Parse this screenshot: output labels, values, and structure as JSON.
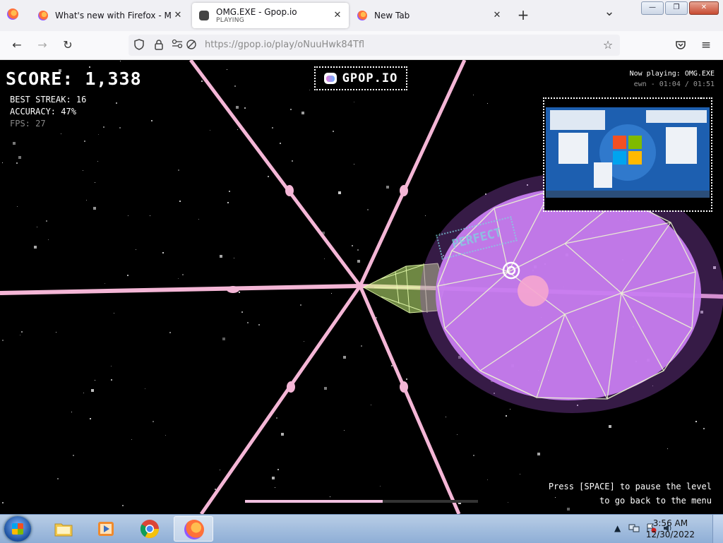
{
  "browser": {
    "tabs": [
      {
        "title": "What's new with Firefox - More",
        "subtitle": "",
        "active": false
      },
      {
        "title": "OMG.EXE - Gpop.io",
        "subtitle": "PLAYING",
        "active": true
      },
      {
        "title": "New Tab",
        "subtitle": "",
        "active": false
      }
    ],
    "new_tab_symbol": "+",
    "tab_list_symbol": "⌄",
    "close_symbol": "✕",
    "window_controls": {
      "minimize": "—",
      "maximize": "❐",
      "close": "✕"
    },
    "nav": {
      "back": "←",
      "forward": "→",
      "reload": "↻"
    },
    "url_prefix": "https://",
    "url_rest": "gpop.io/play/oNuuHwk84Tfl",
    "url_icons": [
      "shield-icon",
      "lock-icon",
      "permissions-icon",
      "tracking-off-icon"
    ],
    "toolbar_icons": [
      "bookmark-star-icon",
      "pocket-icon",
      "menu-icon"
    ]
  },
  "game": {
    "score_label": "SCORE:",
    "score_value": "1,338",
    "best_streak": "BEST STREAK: 16",
    "accuracy": "ACCURACY: 47%",
    "fps": "FPS: 27",
    "logo_text": "GPOP.IO",
    "now_playing": "Now playing: OMG.EXE",
    "artist_time": "ewn - 01:04 / 01:51",
    "judgement": "PERFECT",
    "hint_line1": "Press [SPACE] to pause the level",
    "hint_line2": "to go back to the menu",
    "progress": 0.59,
    "colors": {
      "beam": "#f4b6d6",
      "orb": "#c77dff",
      "wire": "#e9ffb0",
      "accent": "#7fd4e0"
    }
  },
  "taskbar": {
    "items": [
      {
        "name": "explorer",
        "icon": "folder-icon",
        "active": false
      },
      {
        "name": "media-player",
        "icon": "media-player-icon",
        "active": false
      },
      {
        "name": "chrome",
        "icon": "chrome-icon",
        "active": false
      },
      {
        "name": "firefox",
        "icon": "firefox-icon",
        "active": true
      }
    ],
    "tray_icons": [
      "show-hidden-icon",
      "network-icon",
      "action-center-icon",
      "volume-icon"
    ],
    "time": "3:56 AM",
    "date": "12/30/2022"
  }
}
